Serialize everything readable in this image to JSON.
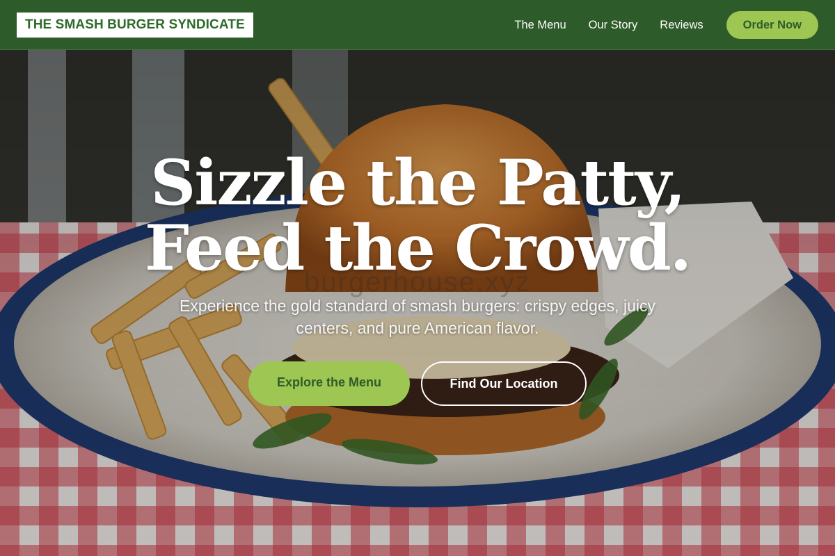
{
  "header": {
    "brand": "THE SMASH BURGER SYNDICATE",
    "nav": [
      {
        "label": "The Menu"
      },
      {
        "label": "Our Story"
      },
      {
        "label": "Reviews"
      }
    ],
    "cta_label": "Order Now"
  },
  "hero": {
    "headline_line1": "Sizzle the Patty,",
    "headline_line2": "Feed the Crowd.",
    "subtitle": "Experience the gold standard of smash burgers: crispy edges, juicy centers, and pure American flavor.",
    "primary_button": "Explore the Menu",
    "secondary_button": "Find Our Location",
    "watermark": "burgerhouse.xyz",
    "background_image": "burger-with-fries-photo"
  },
  "colors": {
    "header_bg": "#2e602a",
    "accent": "#9dc653",
    "accent_text": "#2f5c29",
    "brand_text": "#2e6b2a",
    "headline": "#ffffff"
  }
}
